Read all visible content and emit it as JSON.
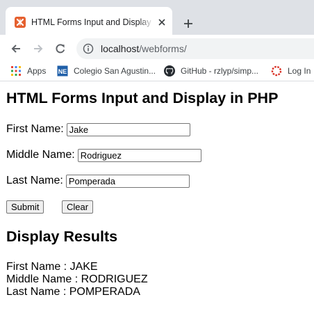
{
  "browser": {
    "tab": {
      "title": "HTML Forms Input and Display in PHP"
    },
    "address_bar": {
      "host": "localhost",
      "path": "/webforms/"
    },
    "bookmarks": [
      {
        "label": "Apps",
        "icon": "apps-grid-icon"
      },
      {
        "label": "Colegio San Agustin...",
        "icon": "ne-favicon-icon"
      },
      {
        "label": "GitHub - rzlyp/simp...",
        "icon": "github-icon"
      },
      {
        "label": "Log In",
        "icon": "login-ring-icon"
      }
    ],
    "colors": {
      "tabbar": "#dee1e6",
      "omnibox": "#f1f3f4",
      "favicon": "#e5602f"
    }
  },
  "page": {
    "heading": "HTML Forms Input and Display in PHP",
    "form": {
      "first_name": {
        "label": "First Name:",
        "value": "Jake"
      },
      "middle_name": {
        "label": "Middle Name:",
        "value": "Rodriguez"
      },
      "last_name": {
        "label": "Last Name:",
        "value": "Pomperada"
      },
      "submit_label": "Submit",
      "clear_label": "Clear"
    },
    "results": {
      "heading": "Display Results",
      "lines": [
        "First Name : JAKE",
        "Middle Name : RODRIGUEZ",
        "Last Name : POMPERADA"
      ]
    }
  }
}
